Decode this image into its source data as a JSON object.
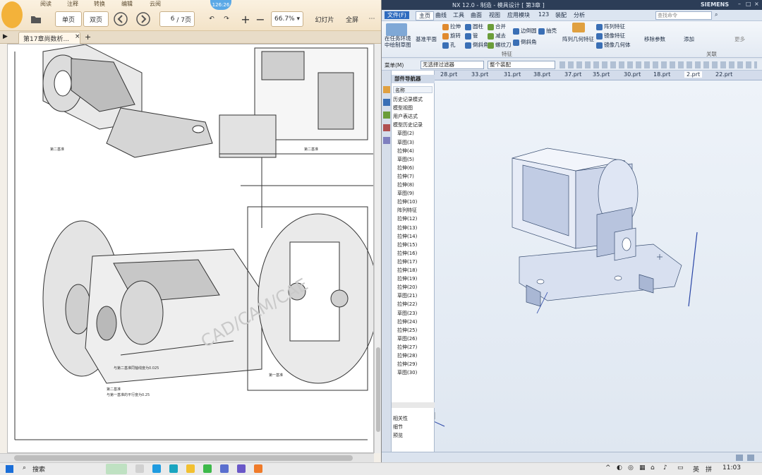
{
  "viewer": {
    "menu": [
      "阅读",
      "注释",
      "转换",
      "编辑",
      "云阅"
    ],
    "view_single": "单页",
    "view_double": "双页",
    "page_value": "6",
    "page_total": "/ 7页",
    "zoom": "66.7%",
    "slideshow": "幻灯片",
    "fullscreen": "全屏",
    "timer": "126:26",
    "doc_tab": "第17章尚数析...",
    "page_labels": {
      "ann1": "第二基准",
      "ann2": "第二基准",
      "ann3": "与第二基准同轴线度为0.025",
      "ann4": "第二基准",
      "ann5": "与第一基准的平行度为0.25",
      "ann6": "第一基准",
      "watermark": "CAD/CAM/CAE"
    }
  },
  "nx": {
    "title": "NX 12.0 - 制造 - 模具设计 [ 第3章 ]",
    "siemens": "SIEMENS",
    "menus": [
      "文件(F)",
      "主页",
      "曲线",
      "工具",
      "曲面",
      "视图",
      "应用模块",
      "123",
      "装配",
      "分析"
    ],
    "search": "查找命令",
    "ribbon": {
      "sketch": "在任务环境\n中绘制草图",
      "datum": "基准平面",
      "items": [
        "拉伸",
        "旋转",
        "孔",
        "圆柱",
        "管",
        "倒斜角",
        "合并",
        "减去",
        "螺纹刀",
        "边倒圆",
        "倒斜角",
        "抽壳",
        "阵列特征",
        "镜像特征",
        "镜像几何体",
        "阵列几何特征",
        "移除参数",
        "添加",
        "更多"
      ],
      "group": "特征",
      "group2": "关联"
    },
    "filter": [
      "菜单(M)",
      "无选择过滤器",
      "整个装配"
    ],
    "part_tabs": [
      "28.prt",
      "33.prt",
      "31.prt",
      "38.prt",
      "37.prt",
      "35.prt",
      "30.prt",
      "18.prt",
      "2.prt",
      "22.prt"
    ],
    "nav": {
      "title": "部件导航器",
      "col": "名称",
      "rows": [
        "历史记录模式",
        "模型视图",
        "用户表达式",
        "模型历史记录",
        "草图(2)",
        "草图(3)",
        "拉伸(4)",
        "草图(5)",
        "拉伸(6)",
        "拉伸(7)",
        "拉伸(8)",
        "草图(9)",
        "拉伸(10)",
        "阵列特征",
        "拉伸(12)",
        "拉伸(13)",
        "拉伸(14)",
        "拉伸(15)",
        "拉伸(16)",
        "拉伸(17)",
        "拉伸(18)",
        "拉伸(19)",
        "拉伸(20)",
        "草图(21)",
        "拉伸(22)",
        "草图(23)",
        "拉伸(24)",
        "拉伸(25)",
        "草图(26)",
        "拉伸(27)",
        "拉伸(28)",
        "拉伸(29)",
        "草图(30)"
      ],
      "footer": [
        "相关性",
        "细节",
        "预览"
      ]
    }
  },
  "taskbar": {
    "search": "搜索",
    "time": "11:03",
    "lang": "英",
    "ime": "拼"
  }
}
